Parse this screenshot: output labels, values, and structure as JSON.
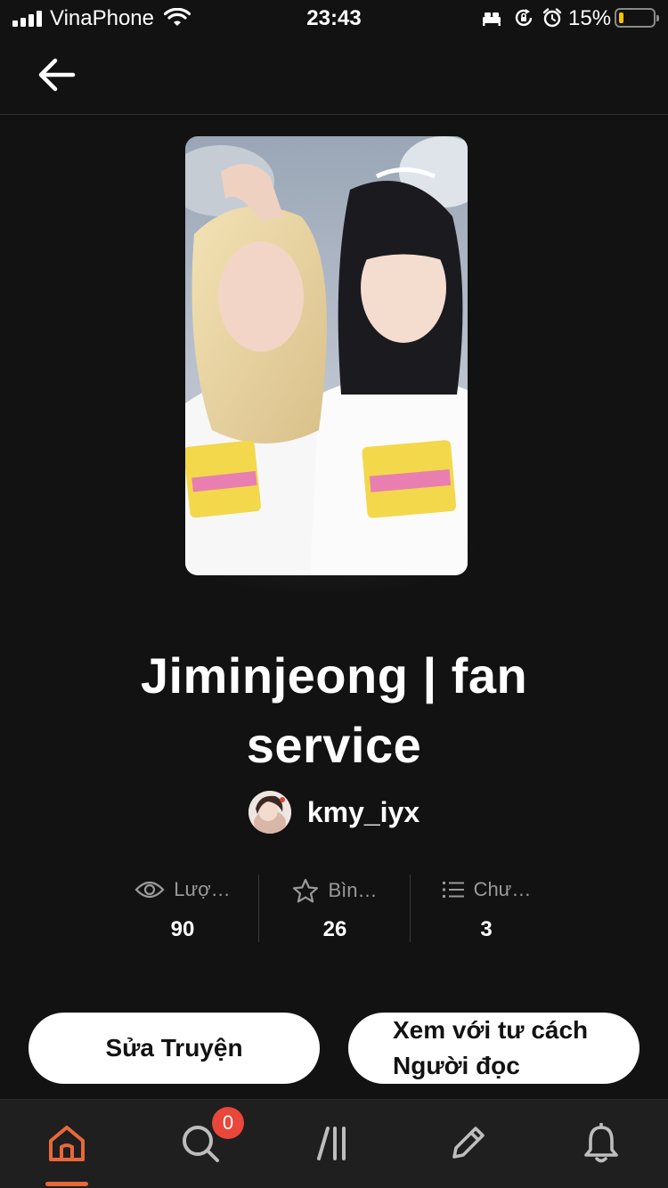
{
  "status_bar": {
    "carrier": "VinaPhone",
    "time": "23:43",
    "battery_percent": "15%",
    "battery_level": 0.15,
    "icons": [
      "signal-icon",
      "wifi-icon",
      "bed-icon",
      "rotation-lock-icon",
      "alarm-icon",
      "battery-icon"
    ]
  },
  "header": {
    "back_icon": "arrow-left-icon"
  },
  "story": {
    "title": "Jiminjeong | fan service",
    "author": "kmy_iyx"
  },
  "stats": [
    {
      "icon": "eye-icon",
      "label": "Lượ…",
      "value": "90"
    },
    {
      "icon": "star-icon",
      "label": "Bìn…",
      "value": "26"
    },
    {
      "icon": "list-icon",
      "label": "Chư…",
      "value": "3"
    }
  ],
  "actions": {
    "edit_label": "Sửa Truyện",
    "view_as_reader_label": "Xem với tư cách Người đọc"
  },
  "bottom_nav": {
    "items": [
      "home-icon",
      "search-icon",
      "library-icon",
      "pencil-icon",
      "bell-icon"
    ],
    "active": "home-icon",
    "library_badge": "0"
  },
  "colors": {
    "accent": "#e8683a",
    "badge": "#e8473a",
    "background": "#121212"
  }
}
